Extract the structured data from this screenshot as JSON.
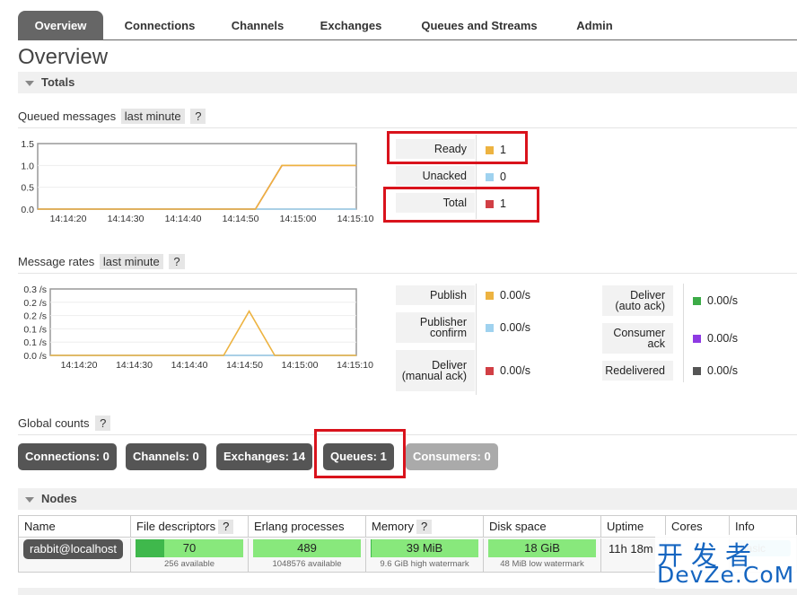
{
  "tabs": [
    {
      "label": "Overview",
      "active": true
    },
    {
      "label": "Connections"
    },
    {
      "label": "Channels"
    },
    {
      "label": "Exchanges"
    },
    {
      "label": "Queues and Streams"
    },
    {
      "label": "Admin"
    }
  ],
  "page_title": "Overview",
  "totals": {
    "title": "Totals"
  },
  "queued": {
    "label": "Queued messages",
    "range": "last minute",
    "help": "?",
    "legend": [
      {
        "label": "Ready",
        "value": "1",
        "color": "#edb341"
      },
      {
        "label": "Unacked",
        "value": "0",
        "color": "#9fd2ef"
      },
      {
        "label": "Total",
        "value": "1",
        "color": "#d13f45"
      }
    ]
  },
  "rates": {
    "label": "Message rates",
    "range": "last minute",
    "help": "?",
    "legend_left": [
      {
        "label": "Publish",
        "value": "0.00/s",
        "color": "#edb341"
      },
      {
        "label": "Publisher confirm",
        "value": "0.00/s",
        "color": "#9fd2ef"
      },
      {
        "label": "Deliver (manual ack)",
        "value": "0.00/s",
        "color": "#d13f45"
      }
    ],
    "legend_right": [
      {
        "label": "Deliver (auto ack)",
        "value": "0.00/s",
        "color": "#3cab47"
      },
      {
        "label": "Consumer ack",
        "value": "0.00/s",
        "color": "#8e3ae3"
      },
      {
        "label": "Redelivered",
        "value": "0.00/s",
        "color": "#555555"
      }
    ]
  },
  "global_counts": {
    "label": "Global counts",
    "help": "?",
    "items": [
      {
        "label": "Connections: 0"
      },
      {
        "label": "Channels: 0"
      },
      {
        "label": "Exchanges: 14"
      },
      {
        "label": "Queues: 1"
      },
      {
        "label": "Consumers: 0",
        "dim": true
      }
    ]
  },
  "nodes": {
    "title": "Nodes",
    "columns": [
      "Name",
      "File descriptors",
      "Erlang processes",
      "Memory",
      "Disk space",
      "Uptime",
      "Cores",
      "Info"
    ],
    "help": "?",
    "row": {
      "name": "rabbit@localhost",
      "fd": {
        "value": "70",
        "sub": "256 available",
        "usage": 0.27
      },
      "erlang": {
        "value": "489",
        "sub": "1048576 available",
        "usage": 0.0005
      },
      "memory": {
        "value": "39 MiB",
        "sub": "9.6 GiB high watermark",
        "usage": 0.004
      },
      "disk": {
        "value": "18 GiB",
        "sub": "48 MiB low watermark",
        "usage": 0
      },
      "uptime": "11h 18m",
      "cores": "",
      "info": "basic"
    }
  },
  "chart_data": [
    {
      "type": "line",
      "title": "Queued messages",
      "x": [
        "14:14:20",
        "14:14:30",
        "14:14:40",
        "14:14:50",
        "14:15:00",
        "14:15:10"
      ],
      "ylim": [
        0,
        1.5
      ],
      "yticks": [
        "1.5",
        "1.0",
        "0.5",
        "0.0"
      ],
      "series": [
        {
          "name": "Ready",
          "color": "#edb341",
          "points": [
            [
              0,
              0
            ],
            [
              41,
              0
            ],
            [
              46,
              1
            ],
            [
              60,
              1
            ]
          ]
        },
        {
          "name": "Unacked",
          "color": "#9fd2ef",
          "points": [
            [
              0,
              0
            ],
            [
              60,
              0
            ]
          ]
        },
        {
          "name": "Total",
          "color": "#d13f45",
          "points": [
            [
              0,
              0
            ],
            [
              41,
              0
            ],
            [
              46,
              1
            ],
            [
              60,
              1
            ]
          ]
        }
      ]
    },
    {
      "type": "line",
      "title": "Message rates",
      "x": [
        "14:14:20",
        "14:14:30",
        "14:14:40",
        "14:14:50",
        "14:15:00",
        "14:15:10"
      ],
      "ylim": [
        0,
        0.3
      ],
      "yticks": [
        "0.3 /s",
        "0.2 /s",
        "0.2 /s",
        "0.1 /s",
        "0.1 /s",
        "0.0 /s"
      ],
      "series": [
        {
          "name": "Publish",
          "color": "#edb341",
          "points": [
            [
              0,
              0
            ],
            [
              34,
              0
            ],
            [
              39,
              0.2
            ],
            [
              44,
              0
            ],
            [
              60,
              0
            ]
          ]
        },
        {
          "name": "Publisher confirm",
          "color": "#9fd2ef",
          "points": [
            [
              0,
              0
            ],
            [
              60,
              0
            ]
          ]
        }
      ]
    }
  ],
  "watermark": {
    "line1": "开发者",
    "line2": "DevZe.CoM"
  }
}
